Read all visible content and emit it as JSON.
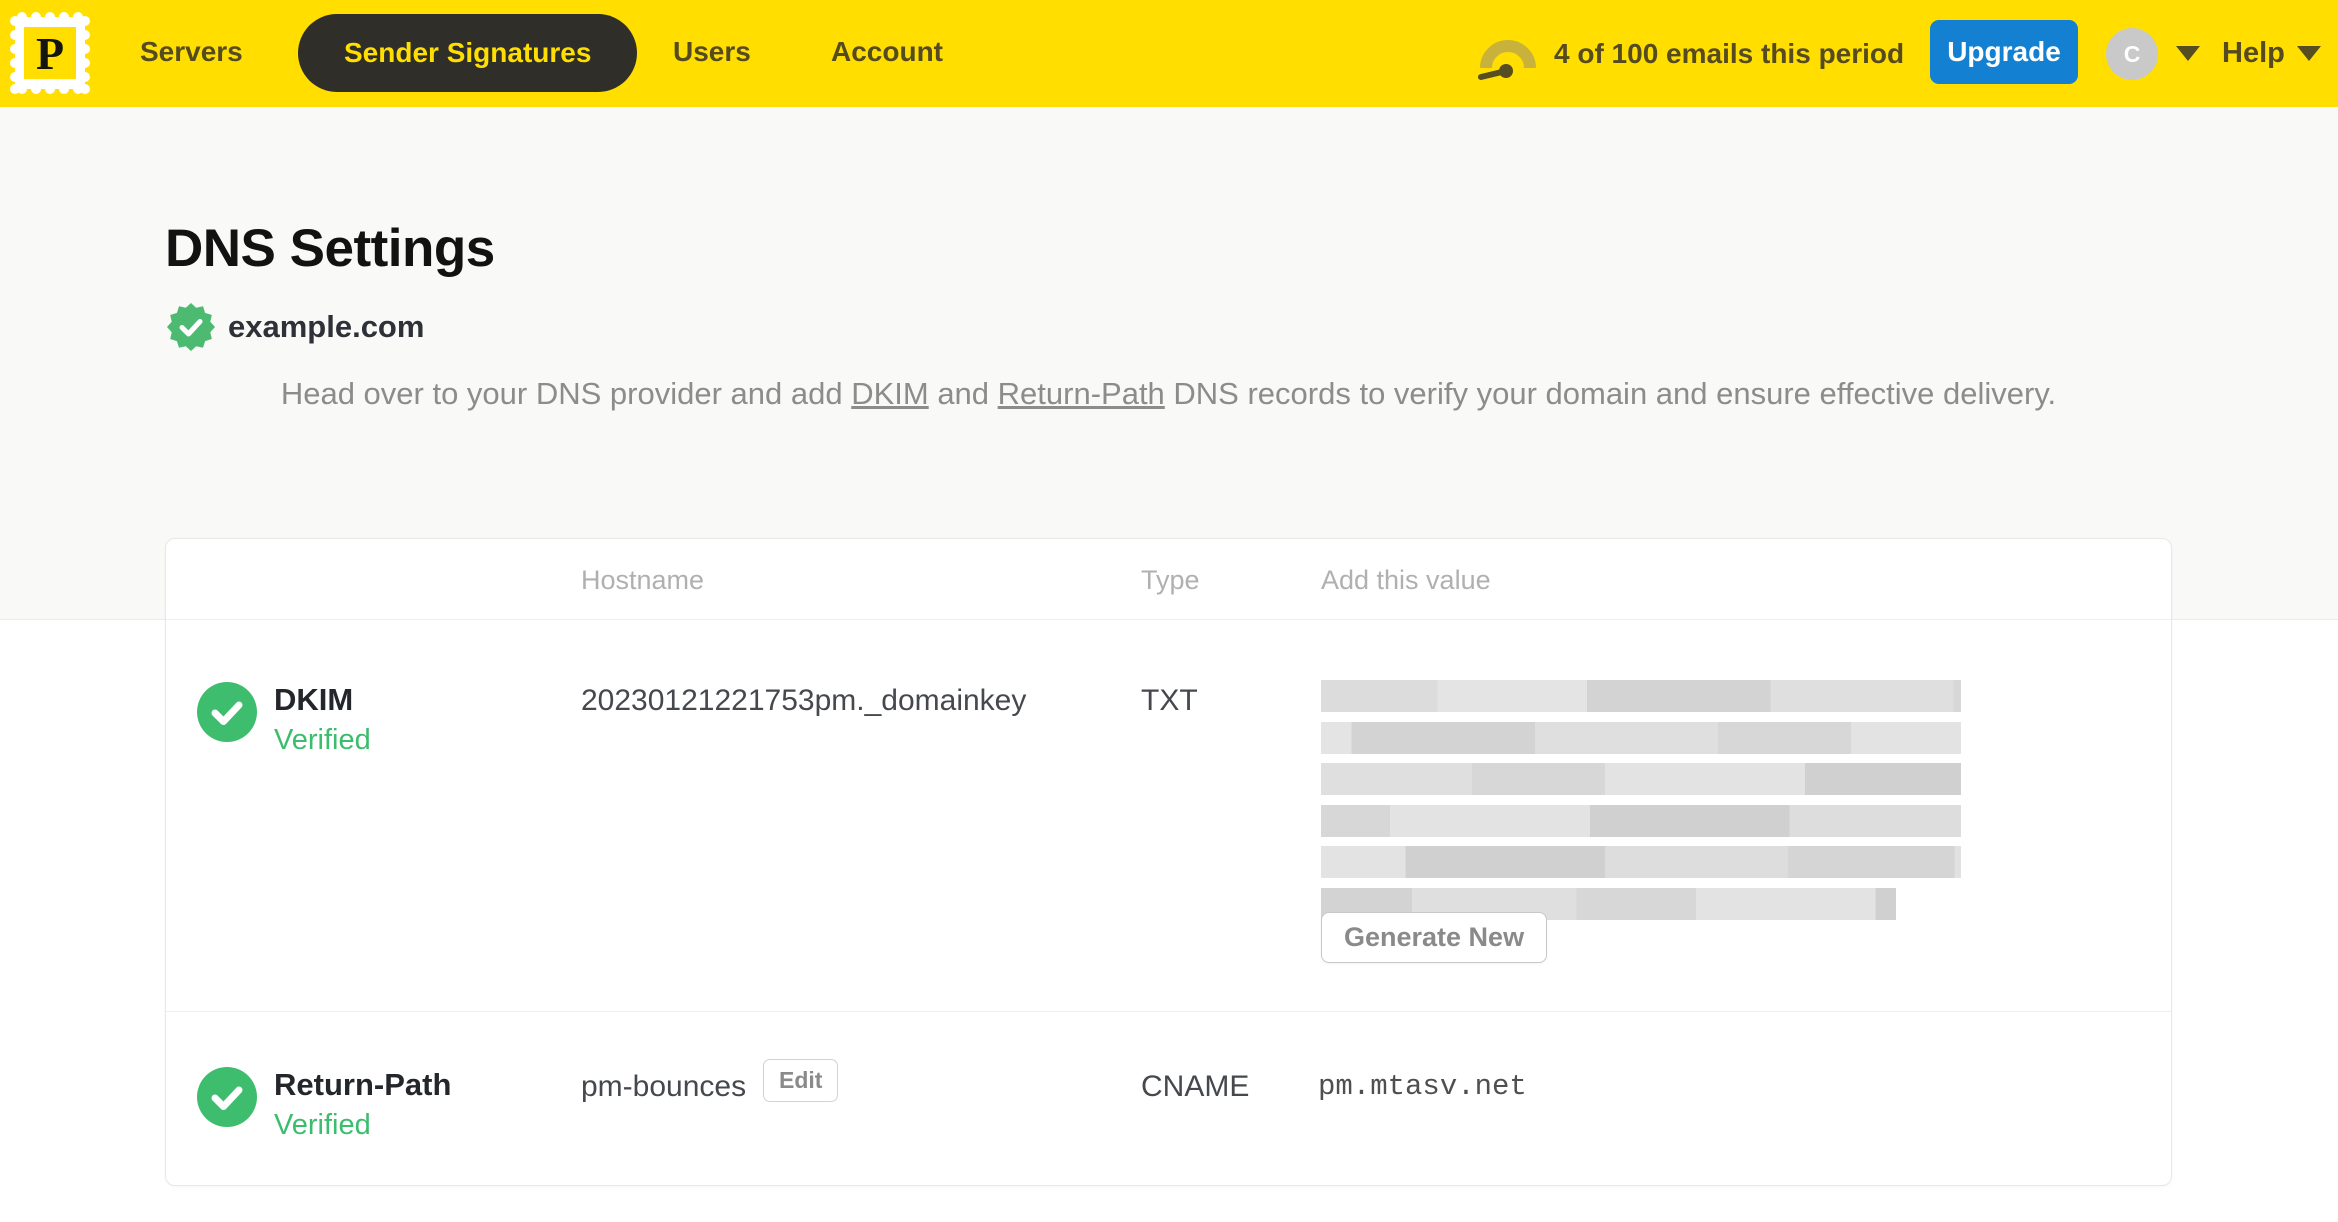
{
  "nav": {
    "logo_letter": "P",
    "items": [
      {
        "label": "Servers",
        "active": false
      },
      {
        "label": "Sender Signatures",
        "active": true
      },
      {
        "label": "Users",
        "active": false
      },
      {
        "label": "Account",
        "active": false
      }
    ],
    "usage_text": "4 of 100 emails this period",
    "upgrade_label": "Upgrade",
    "avatar_initial": "C",
    "help_label": "Help"
  },
  "page": {
    "title": "DNS Settings",
    "domain": "example.com",
    "domain_verified": true,
    "description": {
      "part1": "Head over to your DNS provider and add ",
      "link1": "DKIM",
      "part2": " and ",
      "link2": "Return-Path",
      "part3": " DNS records to verify your domain and ensure effective delivery."
    }
  },
  "table": {
    "headers": {
      "hostname": "Hostname",
      "type": "Type",
      "value": "Add this value"
    },
    "rows": [
      {
        "name": "DKIM",
        "status": "Verified",
        "hostname": "20230121221753pm._domainkey",
        "type": "TXT",
        "value_redacted": true,
        "action_label": "Generate New"
      },
      {
        "name": "Return-Path",
        "status": "Verified",
        "hostname": "pm-bounces",
        "edit_label": "Edit",
        "type": "CNAME",
        "value": "pm.mtasv.net"
      }
    ]
  },
  "colors": {
    "brand_yellow": "#FFDE00",
    "nav_text": "#554B1F",
    "active_pill_bg": "#2F2E29",
    "upgrade_blue": "#1380D2",
    "verified_green": "#3CBD6E",
    "seal_green": "#4CBB71",
    "description_gray": "#8C8C8C",
    "header_label_gray": "#B0B0B0"
  }
}
